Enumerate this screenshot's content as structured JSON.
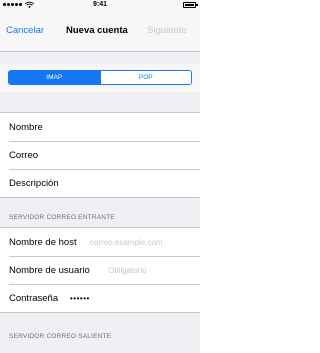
{
  "status_bar": {
    "time": "9:41",
    "icons": [
      "signal-icon",
      "wifi-icon",
      "battery-icon"
    ]
  },
  "nav": {
    "cancel_label": "Cancelar",
    "title": "Nueva cuenta",
    "next_label": "Siguiente"
  },
  "account_type": {
    "options": [
      "IMAP",
      "POP"
    ],
    "selected": "IMAP"
  },
  "account_fields": {
    "rows": [
      {
        "label": "Nombre"
      },
      {
        "label": "Correo"
      },
      {
        "label": "Descripción"
      }
    ]
  },
  "incoming": {
    "header": "SERVIDOR CORREO ENTRANTE",
    "host_label": "Nombre de host",
    "host_placeholder": "correo.example.com",
    "user_label": "Nombre de usuario",
    "user_placeholder": "Obligatorio",
    "password_label": "Contraseña",
    "password_value": "••••••"
  },
  "outgoing": {
    "header": "SERVIDOR CORREO SALIENTE"
  },
  "colors": {
    "accent": "#1577f5",
    "background": "#efeff4",
    "placeholder": "#c7c7cc"
  }
}
